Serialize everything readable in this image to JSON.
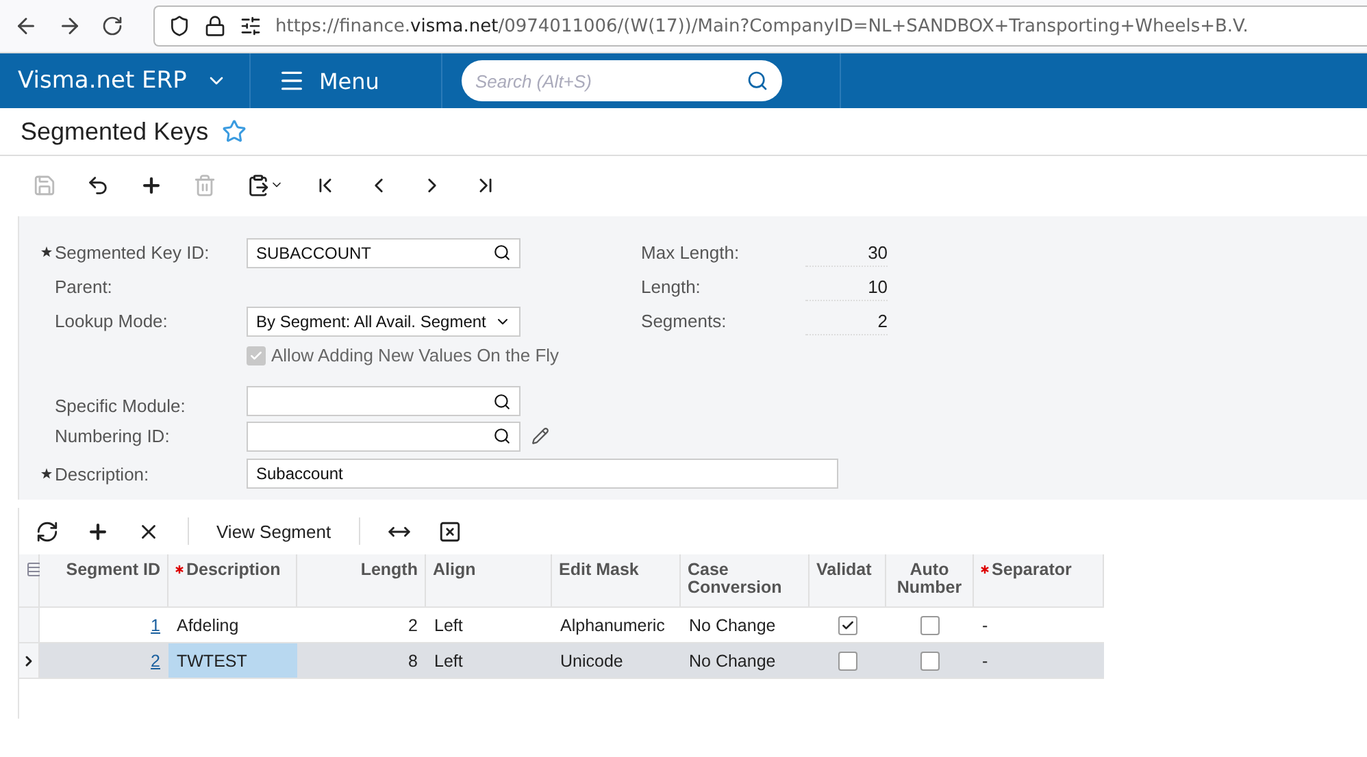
{
  "browser": {
    "url": "https://finance.**visma.net**/0974011006/(W(17))/Main?CompanyID=NL+SANDBOX+Transporting+Wheels+B.V."
  },
  "nav": {
    "brand": "Visma.net ERP",
    "menu": "Menu",
    "search_placeholder": "Search (Alt+S)"
  },
  "page": {
    "title": "Segmented Keys",
    "favorite": false
  },
  "toolbar": [
    {
      "kind": "save",
      "disabled": true
    },
    {
      "kind": "undo",
      "disabled": false
    },
    {
      "kind": "add",
      "disabled": false
    },
    {
      "kind": "delete",
      "disabled": true
    },
    {
      "kind": "paste",
      "disabled": false
    },
    {
      "kind": "first",
      "disabled": false
    },
    {
      "kind": "prev",
      "disabled": false
    },
    {
      "kind": "next",
      "disabled": false
    },
    {
      "kind": "last",
      "disabled": false
    }
  ],
  "form": {
    "fields": [
      {
        "kind": "lookup",
        "label": "Segmented Key ID:",
        "required": true,
        "value": "SUBACCOUNT"
      },
      {
        "kind": "plain",
        "label": "Parent:",
        "required": false
      },
      {
        "kind": "select",
        "label": "Lookup Mode:",
        "required": false,
        "value": "By Segment: All Avail. Segment"
      },
      {
        "kind": "checkbox",
        "label": "Allow Adding New Values On the Fly",
        "checked": true,
        "disabled": true
      },
      {
        "kind": "lookup",
        "label": "Specific Module:",
        "required": false
      },
      {
        "kind": "lookup_edit",
        "label": "Numbering ID:",
        "required": false
      }
    ],
    "stats": [
      {
        "label": "Max Length:",
        "value": "30"
      },
      {
        "label": "Length:",
        "value": "10"
      },
      {
        "label": "Segments:",
        "value": "2"
      }
    ],
    "description": {
      "label": "Description:",
      "required": true,
      "value": "Subaccount"
    }
  },
  "grid_toolbar": [
    {
      "kind": "refresh"
    },
    {
      "kind": "add"
    },
    {
      "kind": "delete"
    },
    {
      "kind": "text",
      "label": "View Segment"
    },
    {
      "kind": "fit"
    },
    {
      "kind": "export"
    }
  ],
  "table": {
    "columns": [
      {
        "label": "Segment ID",
        "required": false
      },
      {
        "label": "Description",
        "required": true
      },
      {
        "label": "Length",
        "required": false
      },
      {
        "label": "Align",
        "required": false
      },
      {
        "label": "Edit Mask",
        "required": false
      },
      {
        "label": "Case Conversion",
        "required": false
      },
      {
        "label": "Validat",
        "required": false
      },
      {
        "label": "Auto Number",
        "required": false
      },
      {
        "label": "Separator",
        "required": true
      }
    ],
    "rows": [
      {
        "selected": false,
        "segment_id": "1",
        "description": "Afdeling",
        "length": "2",
        "align": "Left",
        "edit_mask": "Alphanumeric",
        "case_conversion": "No Change",
        "validate": true,
        "auto_number": false,
        "separator": "-"
      },
      {
        "selected": true,
        "segment_id": "2",
        "description": "TWTEST",
        "length": "8",
        "align": "Left",
        "edit_mask": "Unicode",
        "case_conversion": "No Change",
        "validate": false,
        "auto_number": false,
        "separator": "-"
      }
    ]
  }
}
